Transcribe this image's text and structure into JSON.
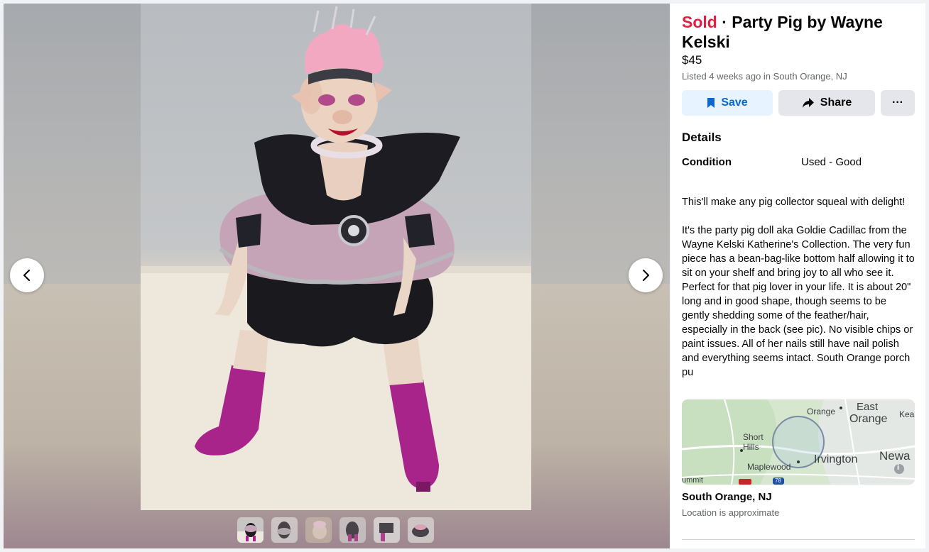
{
  "listing": {
    "status": "Sold",
    "separator": "·",
    "title": "Party Pig by Wayne Kelski",
    "price": "$45",
    "listed": "Listed 4 weeks ago in South Orange, NJ"
  },
  "actions": {
    "save_label": "Save",
    "share_label": "Share",
    "more_label": "···"
  },
  "details": {
    "heading": "Details",
    "condition_label": "Condition",
    "condition_value": "Used - Good"
  },
  "description": {
    "paragraph_1": "This'll make any pig collector squeal with delight!",
    "paragraph_2": "It's the party pig doll aka Goldie Cadillac from the Wayne Kelski Katherine's Collection. The very fun piece has a bean-bag-like bottom half allowing it to sit on your shelf and bring joy to all who see it. Perfect for that pig lover in your life. It is about 20\" long and in good shape, though seems to be gently shedding some of the feather/hair, especially in the back (see pic). No visible chips or paint issues. All of her nails still have nail polish and everything seems intact. South Orange porch pu"
  },
  "map": {
    "labels": {
      "orange": "Orange",
      "east": "East",
      "east_orange": "Orange",
      "kea": "Kea",
      "short": "Short",
      "hills": "Hills",
      "irvington": "Irvington",
      "newa": "Newa",
      "maplewood": "Maplewood",
      "summit": "ummit",
      "route": "78"
    },
    "info_icon": "info-icon"
  },
  "location": {
    "name": "South Orange, NJ",
    "note": "Location is approximate"
  },
  "gallery": {
    "thumbnail_count": 6,
    "active_index": 0
  },
  "colors": {
    "sold": "#e41e3f",
    "save_bg": "#e7f3ff",
    "save_text": "#0a68d0",
    "neutral_button": "#e4e6eb"
  }
}
